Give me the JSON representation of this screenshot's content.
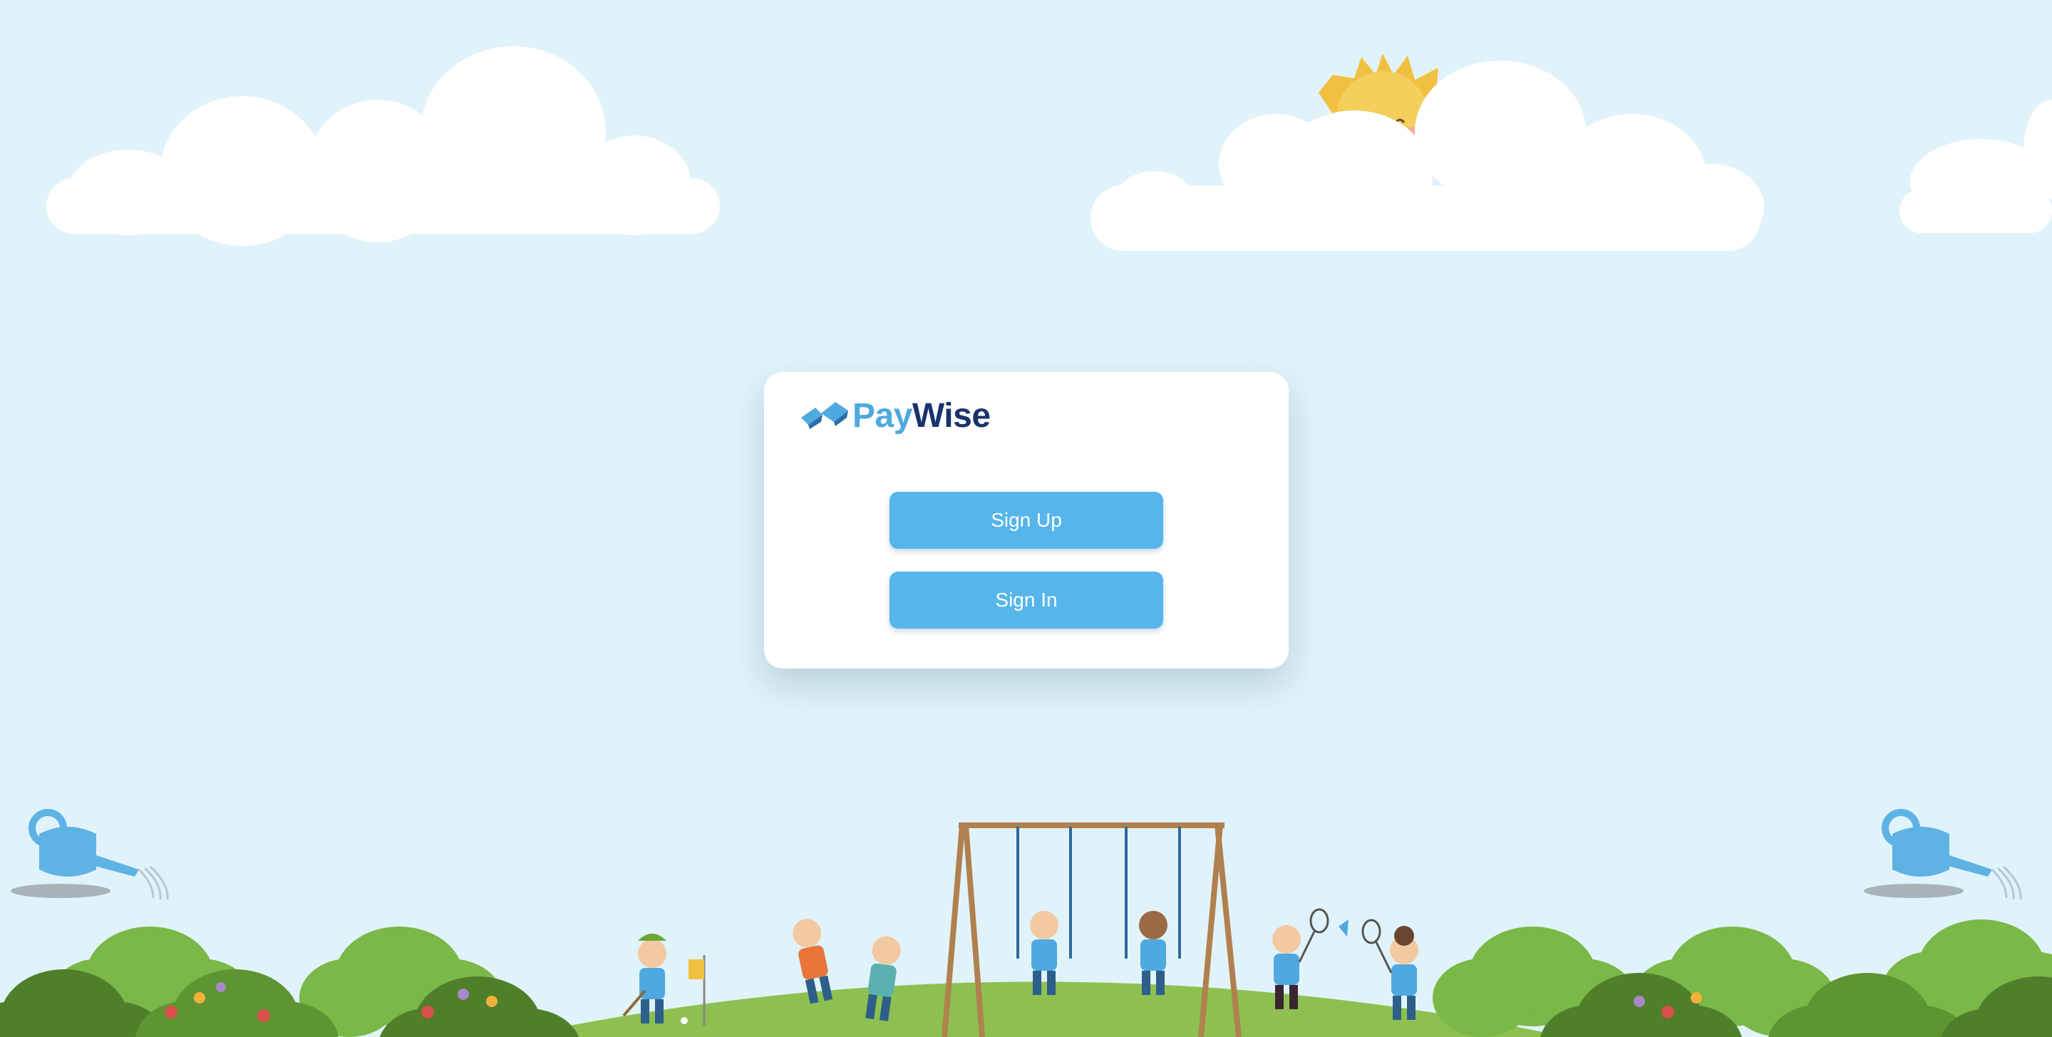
{
  "brand": {
    "name_part1": "Pay",
    "name_part2": "Wise"
  },
  "actions": {
    "sign_up_label": "Sign Up",
    "sign_in_label": "Sign In"
  },
  "colors": {
    "background": "#e1f3fa",
    "button": "#56b5ea",
    "brand_light": "#4fa9df",
    "brand_dark": "#19336b",
    "grass": "#8dc050",
    "bush": "#6fae3a",
    "sun": "#f4cf5c"
  },
  "illustration": {
    "elements": [
      "cloud",
      "sun-face",
      "watering-can",
      "bushes",
      "flowers",
      "golfer-child",
      "running-children",
      "swing-set",
      "children-on-swings",
      "badminton-children"
    ]
  }
}
